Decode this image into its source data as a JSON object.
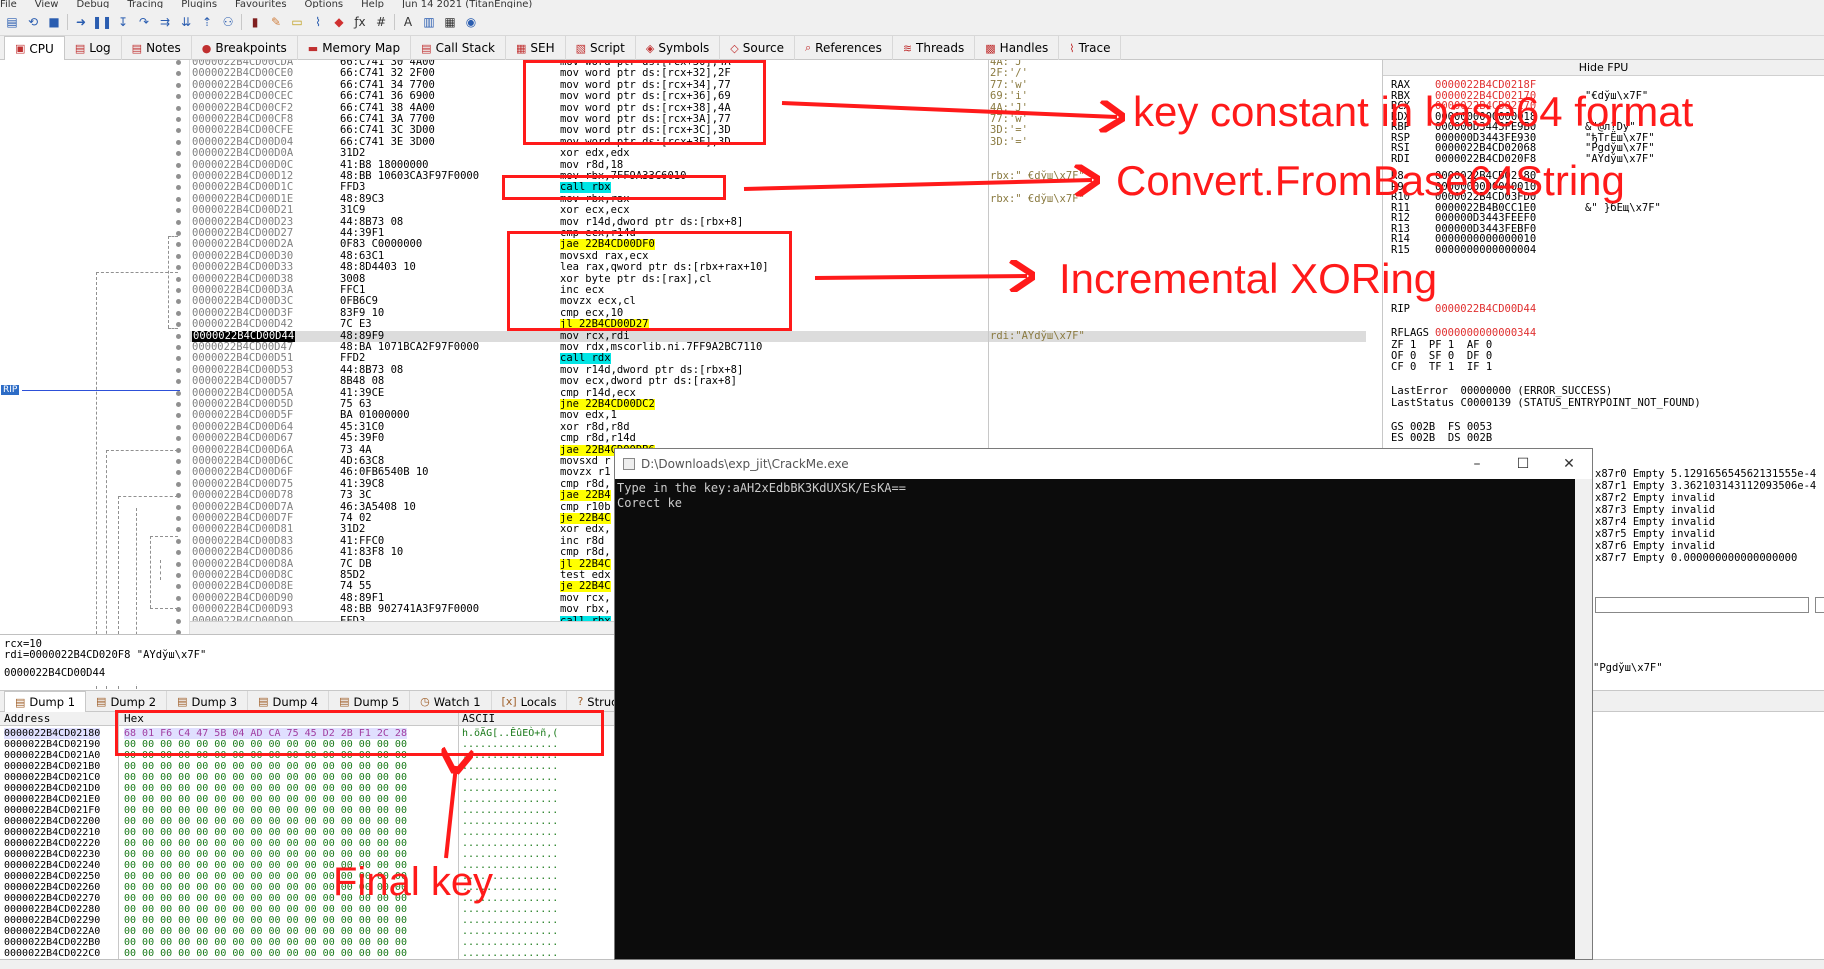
{
  "menu": [
    "File",
    "View",
    "Debug",
    "Tracing",
    "Plugins",
    "Favourites",
    "Options",
    "Help",
    "Jun 14 2021 (TitanEngine)"
  ],
  "tabs": [
    {
      "label": "CPU",
      "icon": "cpu-icon",
      "active": true
    },
    {
      "label": "Log",
      "icon": "log-icon"
    },
    {
      "label": "Notes",
      "icon": "notes-icon"
    },
    {
      "label": "Breakpoints",
      "icon": "breakpoint-icon"
    },
    {
      "label": "Memory Map",
      "icon": "memory-map-icon"
    },
    {
      "label": "Call Stack",
      "icon": "call-stack-icon"
    },
    {
      "label": "SEH",
      "icon": "seh-icon"
    },
    {
      "label": "Script",
      "icon": "script-icon"
    },
    {
      "label": "Symbols",
      "icon": "symbols-icon"
    },
    {
      "label": "Source",
      "icon": "source-icon"
    },
    {
      "label": "References",
      "icon": "references-icon"
    },
    {
      "label": "Threads",
      "icon": "threads-icon"
    },
    {
      "label": "Handles",
      "icon": "handles-icon"
    },
    {
      "label": "Trace",
      "icon": "trace-icon"
    }
  ],
  "disasm": [
    {
      "addr": "0000022B4CD00CDA",
      "bytes": "66:C741 30 4A00",
      "ins": "mov word ptr ds:[rcx+30],4A",
      "cmt": "4A:'J'"
    },
    {
      "addr": "0000022B4CD00CE0",
      "bytes": "66:C741 32 2F00",
      "ins": "mov word ptr ds:[rcx+32],2F",
      "cmt": "2F:'/'"
    },
    {
      "addr": "0000022B4CD00CE6",
      "bytes": "66:C741 34 7700",
      "ins": "mov word ptr ds:[rcx+34],77",
      "cmt": "77:'w'"
    },
    {
      "addr": "0000022B4CD00CEC",
      "bytes": "66:C741 36 6900",
      "ins": "mov word ptr ds:[rcx+36],69",
      "cmt": "69:'i'"
    },
    {
      "addr": "0000022B4CD00CF2",
      "bytes": "66:C741 38 4A00",
      "ins": "mov word ptr ds:[rcx+38],4A",
      "cmt": "4A:'J'"
    },
    {
      "addr": "0000022B4CD00CF8",
      "bytes": "66:C741 3A 7700",
      "ins": "mov word ptr ds:[rcx+3A],77",
      "cmt": "77:'w'"
    },
    {
      "addr": "0000022B4CD00CFE",
      "bytes": "66:C741 3C 3D00",
      "ins": "mov word ptr ds:[rcx+3C],3D",
      "cmt": "3D:'='"
    },
    {
      "addr": "0000022B4CD00D04",
      "bytes": "66:C741 3E 3D00",
      "ins": "mov word ptr ds:[rcx+3E],3D",
      "cmt": "3D:'='"
    },
    {
      "addr": "0000022B4CD00D0A",
      "bytes": "31D2",
      "ins": "xor edx,edx",
      "cmt": ""
    },
    {
      "addr": "0000022B4CD00D0C",
      "bytes": "41:B8 18000000",
      "ins": "mov r8d,18",
      "cmt": ""
    },
    {
      "addr": "0000022B4CD00D12",
      "bytes": "48:BB 10603CA3F97F0000",
      "ins": "mov rbx,7FF9A33C6010",
      "cmt": "rbx:\" €dўш\\x7F\""
    },
    {
      "addr": "0000022B4CD00D1C",
      "bytes": "FFD3",
      "ins": "call rbx",
      "cmt": ""
    },
    {
      "addr": "0000022B4CD00D1E",
      "bytes": "48:89C3",
      "ins": "mov rbx,rax",
      "cmt": "rbx:\" €dўш\\x7F\""
    },
    {
      "addr": "0000022B4CD00D21",
      "bytes": "31C9",
      "ins": "xor ecx,ecx",
      "cmt": ""
    },
    {
      "addr": "0000022B4CD00D23",
      "bytes": "44:8B73 08",
      "ins": "mov r14d,dword ptr ds:[rbx+8]",
      "cmt": ""
    },
    {
      "addr": "0000022B4CD00D27",
      "bytes": "44:39F1",
      "ins": "cmp ecx,r14d",
      "cmt": ""
    },
    {
      "addr": "0000022B4CD00D2A",
      "bytes": "0F83 C0000000",
      "ins": "jae 22B4CD00DF0",
      "cmt": ""
    },
    {
      "addr": "0000022B4CD00D30",
      "bytes": "48:63C1",
      "ins": "movsxd rax,ecx",
      "cmt": ""
    },
    {
      "addr": "0000022B4CD00D33",
      "bytes": "48:8D4403 10",
      "ins": "lea rax,qword ptr ds:[rbx+rax+10]",
      "cmt": ""
    },
    {
      "addr": "0000022B4CD00D38",
      "bytes": "3008",
      "ins": "xor byte ptr ds:[rax],cl",
      "cmt": ""
    },
    {
      "addr": "0000022B4CD00D3A",
      "bytes": "FFC1",
      "ins": "inc ecx",
      "cmt": ""
    },
    {
      "addr": "0000022B4CD00D3C",
      "bytes": "0FB6C9",
      "ins": "movzx ecx,cl",
      "cmt": ""
    },
    {
      "addr": "0000022B4CD00D3F",
      "bytes": "83F9 10",
      "ins": "cmp ecx,10",
      "cmt": ""
    },
    {
      "addr": "0000022B4CD00D42",
      "bytes": "7C E3",
      "ins": "jl 22B4CD00D27",
      "cmt": ""
    },
    {
      "addr": "0000022B4CD00D44",
      "bytes": "48:89F9",
      "ins": "mov rcx,rdi",
      "cmt": "rdi:\"AYdўш\\x7F\""
    },
    {
      "addr": "0000022B4CD00D47",
      "bytes": "48:BA 1071BCA2F97F0000",
      "ins": "mov rdx,mscorlib.ni.7FF9A2BC7110",
      "cmt": ""
    },
    {
      "addr": "0000022B4CD00D51",
      "bytes": "FFD2",
      "ins": "call rdx",
      "cmt": ""
    },
    {
      "addr": "0000022B4CD00D53",
      "bytes": "44:8B73 08",
      "ins": "mov r14d,dword ptr ds:[rbx+8]",
      "cmt": ""
    },
    {
      "addr": "0000022B4CD00D57",
      "bytes": "8B48 08",
      "ins": "mov ecx,dword ptr ds:[rax+8]",
      "cmt": ""
    },
    {
      "addr": "0000022B4CD00D5A",
      "bytes": "41:39CE",
      "ins": "cmp r14d,ecx",
      "cmt": ""
    },
    {
      "addr": "0000022B4CD00D5D",
      "bytes": "75 63",
      "ins": "jne 22B4CD00DC2",
      "cmt": ""
    },
    {
      "addr": "0000022B4CD00D5F",
      "bytes": "BA 01000000",
      "ins": "mov edx,1",
      "cmt": ""
    },
    {
      "addr": "0000022B4CD00D64",
      "bytes": "45:31C0",
      "ins": "xor r8d,r8d",
      "cmt": ""
    },
    {
      "addr": "0000022B4CD00D67",
      "bytes": "45:39F0",
      "ins": "cmp r8d,r14d",
      "cmt": ""
    },
    {
      "addr": "0000022B4CD00D6A",
      "bytes": "73 4A",
      "ins": "jae 22B4CD00DB6",
      "cmt": ""
    },
    {
      "addr": "0000022B4CD00D6C",
      "bytes": "4D:63C8",
      "ins": "movsxd r",
      "cmt": ""
    },
    {
      "addr": "0000022B4CD00D6F",
      "bytes": "46:0FB6540B 10",
      "ins": "movzx r1",
      "cmt": ""
    },
    {
      "addr": "0000022B4CD00D75",
      "bytes": "41:39C8",
      "ins": "cmp r8d,",
      "cmt": ""
    },
    {
      "addr": "0000022B4CD00D78",
      "bytes": "73 3C",
      "ins": "jae 22B4",
      "cmt": ""
    },
    {
      "addr": "0000022B4CD00D7A",
      "bytes": "46:3A5408 10",
      "ins": "cmp r10b",
      "cmt": ""
    },
    {
      "addr": "0000022B4CD00D7F",
      "bytes": "74 02",
      "ins": "je 22B4C",
      "cmt": ""
    },
    {
      "addr": "0000022B4CD00D81",
      "bytes": "31D2",
      "ins": "xor edx,",
      "cmt": ""
    },
    {
      "addr": "0000022B4CD00D83",
      "bytes": "41:FFC0",
      "ins": "inc r8d",
      "cmt": ""
    },
    {
      "addr": "0000022B4CD00D86",
      "bytes": "41:83F8 10",
      "ins": "cmp r8d,",
      "cmt": ""
    },
    {
      "addr": "0000022B4CD00D8A",
      "bytes": "7C DB",
      "ins": "jl 22B4C",
      "cmt": ""
    },
    {
      "addr": "0000022B4CD00D8C",
      "bytes": "85D2",
      "ins": "test edx",
      "cmt": ""
    },
    {
      "addr": "0000022B4CD00D8E",
      "bytes": "74 55",
      "ins": "je 22B4C",
      "cmt": ""
    },
    {
      "addr": "0000022B4CD00D90",
      "bytes": "48:89F1",
      "ins": "mov rcx,",
      "cmt": ""
    },
    {
      "addr": "0000022B4CD00D93",
      "bytes": "48:BB 902741A3F97F0000",
      "ins": "mov rbx,",
      "cmt": ""
    },
    {
      "addr": "0000022B4CD00D9D",
      "bytes": "FFD3",
      "ins": "call rbx",
      "cmt": ""
    },
    {
      "addr": "0000022B4CD00D9F",
      "bytes": "48:8D4D C0",
      "ins": "lea rcx,",
      "cmt": ""
    }
  ],
  "info": {
    "line1": "rcx=10",
    "line2": "rdi=0000022B4CD020F8 \"AYdўш\\x7F\"",
    "line3": "0000022B4CD00D44"
  },
  "regs": {
    "hide_fpu": "Hide FPU",
    "lines": [
      [
        "RAX",
        "0000022B4CD0218F",
        ""
      ],
      [
        "RBX",
        "0000022B4CD02170",
        "\"€dўш\\x7F\""
      ],
      [
        "RCX",
        "0000022B4CD02170",
        ""
      ],
      [
        "RDX",
        "0000000000000018",
        ""
      ],
      [
        "RBP",
        "000000D3443FE9B0",
        "&\"@л?Dy\""
      ],
      [
        "RSP",
        "000000D3443FE930",
        "\"ђТгЁш\\x7F\""
      ],
      [
        "RSI",
        "0000022B4CD02068",
        "\"Pgdўш\\x7F\""
      ],
      [
        "RDI",
        "0000022B4CD020F8",
        "\"AYdўш\\x7F\""
      ],
      [
        "R8",
        "0000022B4CD02180",
        ""
      ],
      [
        "R9",
        "0000000000000010",
        ""
      ],
      [
        "R10",
        "0000022B4CD03FD0",
        ""
      ],
      [
        "R11",
        "0000022B4B0CC1E0",
        "&\" }бЕщ\\x7F\""
      ],
      [
        "R12",
        "000000D3443FEEF0",
        ""
      ],
      [
        "R13",
        "000000D3443FEBF0",
        ""
      ],
      [
        "R14",
        "0000000000000010",
        ""
      ],
      [
        "R15",
        "0000000000000004",
        ""
      ]
    ],
    "rip_label": "RIP",
    "rip": "0000022B4CD00D44",
    "rflags_label": "RFLAGS",
    "rflags": "0000000000000344",
    "flags1": "ZF 1  PF 1  AF 0",
    "flags2": "OF 0  SF 0  DF 0",
    "flags3": "CF 0  TF 1  IF 1",
    "lasterror": "LastError  00000000 (ERROR_SUCCESS)",
    "laststatus": "LastStatus C0000139 (STATUS_ENTRYPOINT_NOT_FOUND)",
    "seg1": "GS 002B  FS 0053",
    "seg2": "ES 002B  DS 002B"
  },
  "fpu": [
    "x87r0 Empty 5.129165654562131555e-4",
    "x87r1 Empty 3.362103143112093506e-4",
    "x87r2 Empty invalid",
    "x87r3 Empty invalid",
    "x87r4 Empty invalid",
    "x87r5 Empty invalid",
    "x87r6 Empty invalid",
    "x87r7 Empty 0.000000000000000000"
  ],
  "fpu_extra": "\"Pgdўш\\x7F\"",
  "dump_tabs": [
    "Dump 1",
    "Dump 2",
    "Dump 3",
    "Dump 4",
    "Dump 5",
    "Watch 1",
    "Locals",
    "Struct"
  ],
  "dump_header": {
    "address": "Address",
    "hex": "Hex",
    "ascii": "ASCII"
  },
  "dump_rows": [
    {
      "a": "0000022B4CD02180",
      "h": "68 01 F6 C4 47 5B 04 AD CA 75 45 D2 2B F1 2C 28",
      "s": "h.öÄG[..ÊûEÒ+ñ,("
    },
    {
      "a": "0000022B4CD02190",
      "h": "00 00 00 00 00 00 00 00 00 00 00 00 00 00 00 00",
      "s": "................"
    },
    {
      "a": "0000022B4CD021A0",
      "h": "00 00 00 00 00 00 00 00 00 00 00 00 00 00 00 00",
      "s": "................"
    },
    {
      "a": "0000022B4CD021B0",
      "h": "00 00 00 00 00 00 00 00 00 00 00 00 00 00 00 00",
      "s": "................"
    },
    {
      "a": "0000022B4CD021C0",
      "h": "00 00 00 00 00 00 00 00 00 00 00 00 00 00 00 00",
      "s": "................"
    },
    {
      "a": "0000022B4CD021D0",
      "h": "00 00 00 00 00 00 00 00 00 00 00 00 00 00 00 00",
      "s": "................"
    },
    {
      "a": "0000022B4CD021E0",
      "h": "00 00 00 00 00 00 00 00 00 00 00 00 00 00 00 00",
      "s": "................"
    },
    {
      "a": "0000022B4CD021F0",
      "h": "00 00 00 00 00 00 00 00 00 00 00 00 00 00 00 00",
      "s": "................"
    },
    {
      "a": "0000022B4CD02200",
      "h": "00 00 00 00 00 00 00 00 00 00 00 00 00 00 00 00",
      "s": "................"
    },
    {
      "a": "0000022B4CD02210",
      "h": "00 00 00 00 00 00 00 00 00 00 00 00 00 00 00 00",
      "s": "................"
    },
    {
      "a": "0000022B4CD02220",
      "h": "00 00 00 00 00 00 00 00 00 00 00 00 00 00 00 00",
      "s": "................"
    },
    {
      "a": "0000022B4CD02230",
      "h": "00 00 00 00 00 00 00 00 00 00 00 00 00 00 00 00",
      "s": "................"
    },
    {
      "a": "0000022B4CD02240",
      "h": "00 00 00 00 00 00 00 00 00 00 00 00 00 00 00 00",
      "s": "................"
    },
    {
      "a": "0000022B4CD02250",
      "h": "00 00 00 00 00 00 00 00 00 00 00 00 00 00 00 00",
      "s": "................"
    },
    {
      "a": "0000022B4CD02260",
      "h": "00 00 00 00 00 00 00 00 00 00 00 00 00 00 00 00",
      "s": "................"
    },
    {
      "a": "0000022B4CD02270",
      "h": "00 00 00 00 00 00 00 00 00 00 00 00 00 00 00 00",
      "s": "................"
    },
    {
      "a": "0000022B4CD02280",
      "h": "00 00 00 00 00 00 00 00 00 00 00 00 00 00 00 00",
      "s": "................"
    },
    {
      "a": "0000022B4CD02290",
      "h": "00 00 00 00 00 00 00 00 00 00 00 00 00 00 00 00",
      "s": "................"
    },
    {
      "a": "0000022B4CD022A0",
      "h": "00 00 00 00 00 00 00 00 00 00 00 00 00 00 00 00",
      "s": "................"
    },
    {
      "a": "0000022B4CD022B0",
      "h": "00 00 00 00 00 00 00 00 00 00 00 00 00 00 00 00",
      "s": "................"
    },
    {
      "a": "0000022B4CD022C0",
      "h": "00 00 00 00 00 00 00 00 00 00 00 00 00 00 00 00",
      "s": "................"
    }
  ],
  "console": {
    "title": "D:\\Downloads\\exp_jit\\CrackMe.exe",
    "line1": "Type in the key:aAH2xEdbBK3KdUXSK/EsKA==",
    "line2": "Corect ke"
  },
  "annotations": {
    "a1": "key constant in base64 format",
    "a2": "Convert.FromBase64String",
    "a3": "Incremental XORing",
    "a4": "Final key"
  },
  "colors": {
    "annotation": "#ff1a1a",
    "selection": "#2d6cc6",
    "call_highlight": "#00e5e5",
    "jump_highlight": "#ffff00"
  }
}
